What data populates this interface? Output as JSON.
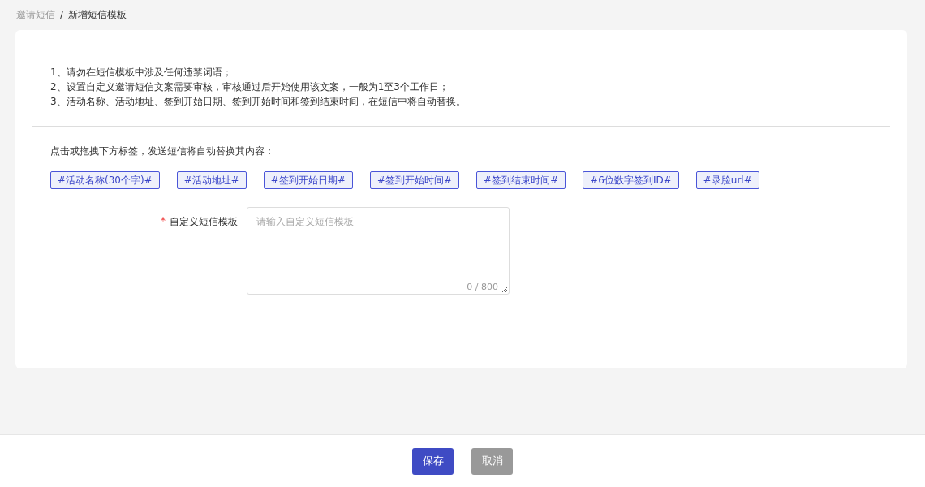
{
  "breadcrumb": [
    {
      "label": "邀请短信",
      "current": false
    },
    {
      "label": "新增短信模板",
      "current": true
    }
  ],
  "breadcrumb_separator": "/",
  "notes": [
    "1、请勿在短信模板中涉及任何违禁词语；",
    "2、设置自定义邀请短信文案需要审核，审核通过后开始使用该文案，一般为1至3个工作日；",
    "3、活动名称、活动地址、签到开始日期、签到开始时间和签到结束时间，在短信中将自动替换。"
  ],
  "tags_hint": "点击或拖拽下方标签，发送短信将自动替换其内容：",
  "tags": [
    "#活动名称(30个字)#",
    "#活动地址#",
    "#签到开始日期#",
    "#签到开始时间#",
    "#签到结束时间#",
    "#6位数字签到ID#",
    "#录脸url#"
  ],
  "field": {
    "required_mark": "*",
    "label": "自定义短信模板",
    "placeholder": "请输入自定义短信模板",
    "counter": "0 / 800"
  },
  "buttons": [
    {
      "label": "保存",
      "kind": "primary"
    },
    {
      "label": "取消",
      "kind": "secondary"
    }
  ]
}
